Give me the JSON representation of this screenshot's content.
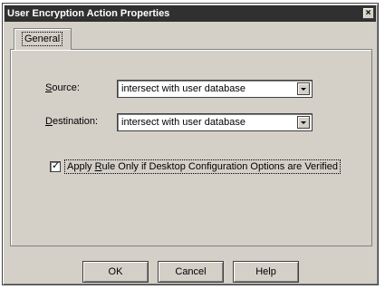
{
  "window": {
    "title": "User Encryption Action Properties",
    "close_symbol": "×"
  },
  "tabs": [
    {
      "label": "General"
    }
  ],
  "fields": {
    "source": {
      "label_prefix": "S",
      "label_rest": "ource:",
      "value": "intersect with user database"
    },
    "destination": {
      "label_prefix": "D",
      "label_rest": "estination:",
      "value": "intersect with user database"
    }
  },
  "checkbox": {
    "label_before": "Apply ",
    "label_accel": "R",
    "label_after": "ule Only if Desktop Configuration Options are Verified",
    "checked_mark": "✓"
  },
  "buttons": {
    "ok": "OK",
    "cancel": "Cancel",
    "help": "Help"
  }
}
